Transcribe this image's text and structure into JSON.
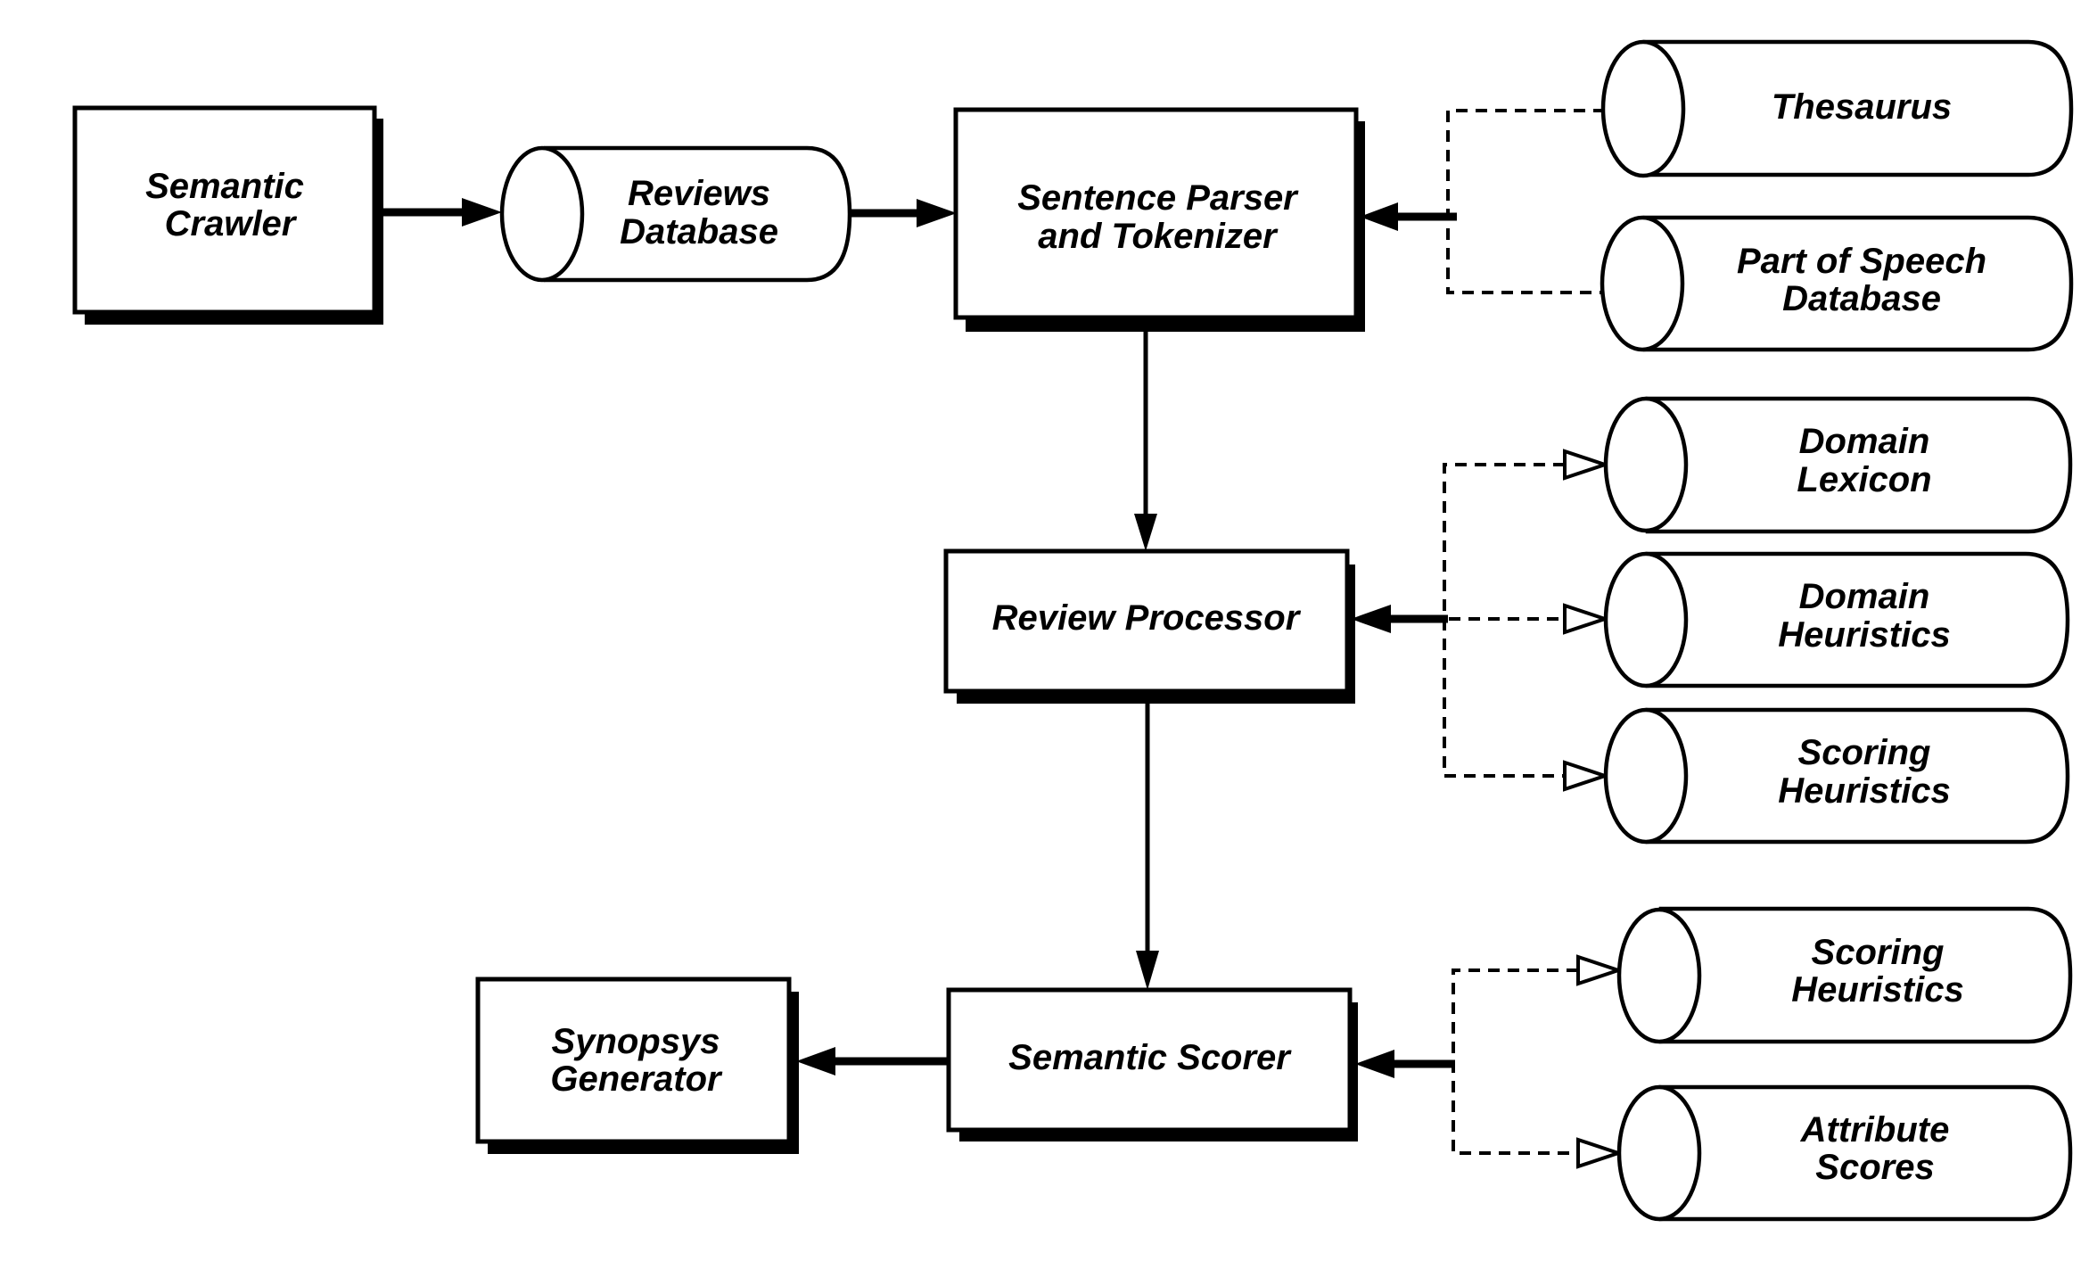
{
  "diagram": {
    "processes": [
      {
        "id": "crawler",
        "lines": [
          "Semantic",
          "Crawler"
        ]
      },
      {
        "id": "parser",
        "lines": [
          "Sentence Parser",
          "and Tokenizer"
        ]
      },
      {
        "id": "processor",
        "lines": [
          "Review Processor"
        ]
      },
      {
        "id": "scorer",
        "lines": [
          "Semantic Scorer"
        ]
      },
      {
        "id": "synopsys",
        "lines": [
          "Synopsys",
          "Generator"
        ]
      }
    ],
    "stores": [
      {
        "id": "reviews-db",
        "lines": [
          "Reviews",
          "Database"
        ]
      },
      {
        "id": "thesaurus",
        "lines": [
          "Thesaurus"
        ]
      },
      {
        "id": "pos-db",
        "lines": [
          "Part of Speech",
          "Database"
        ]
      },
      {
        "id": "domain-lexicon",
        "lines": [
          "Domain",
          "Lexicon"
        ]
      },
      {
        "id": "domain-heuristics",
        "lines": [
          "Domain",
          "Heuristics"
        ]
      },
      {
        "id": "scoring-heuristics-1",
        "lines": [
          "Scoring",
          "Heuristics"
        ]
      },
      {
        "id": "scoring-heuristics-2",
        "lines": [
          "Scoring",
          "Heuristics"
        ]
      },
      {
        "id": "attribute-scores",
        "lines": [
          "Attribute",
          "Scores"
        ]
      }
    ],
    "flows": [
      {
        "from": "Semantic Crawler",
        "to": "Reviews Database",
        "style": "solid"
      },
      {
        "from": "Reviews Database",
        "to": "Sentence Parser and Tokenizer",
        "style": "solid"
      },
      {
        "from": "Thesaurus",
        "to": "Sentence Parser and Tokenizer",
        "style": "dashed"
      },
      {
        "from": "Part of Speech Database",
        "to": "Sentence Parser and Tokenizer",
        "style": "dashed"
      },
      {
        "from": "Sentence Parser and Tokenizer",
        "to": "Review Processor",
        "style": "solid"
      },
      {
        "from": "Domain Lexicon",
        "to": "Review Processor",
        "style": "dashed-bidirectional"
      },
      {
        "from": "Domain Heuristics",
        "to": "Review Processor",
        "style": "dashed-bidirectional"
      },
      {
        "from": "Scoring Heuristics",
        "to": "Review Processor",
        "style": "dashed-bidirectional"
      },
      {
        "from": "Review Processor",
        "to": "Semantic Scorer",
        "style": "solid"
      },
      {
        "from": "Scoring Heuristics",
        "to": "Semantic Scorer",
        "style": "dashed-bidirectional"
      },
      {
        "from": "Attribute Scores",
        "to": "Semantic Scorer",
        "style": "dashed-bidirectional"
      },
      {
        "from": "Semantic Scorer",
        "to": "Synopsys Generator",
        "style": "solid"
      }
    ]
  }
}
